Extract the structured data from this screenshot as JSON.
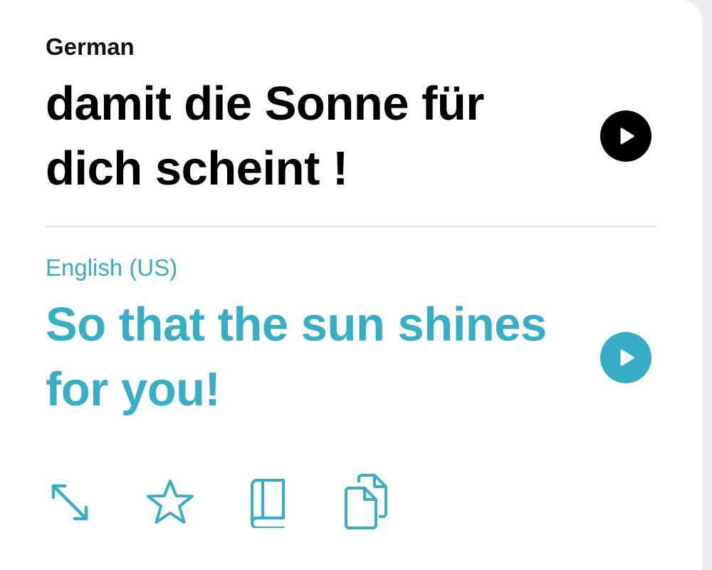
{
  "source": {
    "language": "German",
    "text": "damit die Sonne für dich scheint !",
    "play_icon": "play-circle-filled-icon",
    "color": "#000000"
  },
  "target": {
    "language": "English (US)",
    "text": "So that the sun shines for you!",
    "play_icon": "play-circle-filled-icon",
    "color": "#37aec6"
  },
  "toolbar": {
    "items": [
      {
        "name": "expand",
        "icon": "expand-arrows-icon"
      },
      {
        "name": "favorite",
        "icon": "star-outline-icon"
      },
      {
        "name": "dictionary",
        "icon": "book-icon"
      },
      {
        "name": "copy",
        "icon": "copy-documents-icon"
      }
    ]
  },
  "colors": {
    "accent": "#37aec6",
    "background": "#ffffff",
    "divider": "#dedfe3"
  }
}
